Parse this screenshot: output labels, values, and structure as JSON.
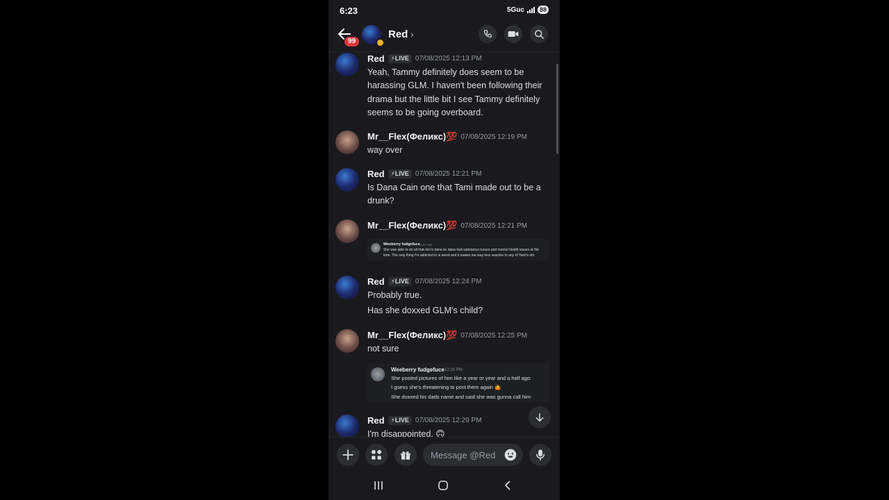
{
  "status_bar": {
    "time": "6:23",
    "network": "5Guc",
    "battery": "88"
  },
  "header": {
    "title": "Red",
    "unread_count": "99",
    "chevron": "›"
  },
  "icons": {
    "back": "arrow-left-icon",
    "call": "phone-icon",
    "video": "video-camera-icon",
    "search": "search-icon",
    "add": "plus-icon",
    "apps": "apps-icon",
    "gift": "gift-icon",
    "emoji": "emoji-icon",
    "mic": "microphone-icon",
    "jump": "arrow-down-icon",
    "recents": "recents-icon",
    "home": "home-icon",
    "nav_back": "chevron-left-icon"
  },
  "colors": {
    "background": "#1a1a1e",
    "badge": "#da373c",
    "idle": "#f0b232",
    "text": "#dbdee1"
  },
  "messages": [
    {
      "author": "Red",
      "tag": "⚡LIVE",
      "timestamp": "07/08/2025 12:13 PM",
      "lines": [
        "Yeah, Tammy definitely does seem to be harassing GLM. I haven't been following their drama but the little bit I see Tammy definitely seems to be going overboard."
      ]
    },
    {
      "author": "Mr__Flex(Феликс)💯",
      "timestamp": "07/08/2025 12:19 PM",
      "lines": [
        "way over"
      ]
    },
    {
      "author": "Red",
      "tag": "⚡LIVE",
      "timestamp": "07/08/2025 12:21 PM",
      "lines": [
        "Is Dana Cain one that Tami made out to be a drunk?"
      ]
    },
    {
      "author": "Mr__Flex(Феликс)💯",
      "timestamp": "07/08/2025 12:21 PM",
      "embed": {
        "name": "Weeberry fudgefuce",
        "time": "11:57 AM",
        "lines": [
          "She was able to do all that sht to dana bc dana had substance issues and mental health issues at the",
          "time. The only thing I'm addicted to is weed and it makes me way less reactive to any of Tami's sht"
        ]
      }
    },
    {
      "author": "Red",
      "tag": "⚡LIVE",
      "timestamp": "07/08/2025 12:24 PM",
      "lines": [
        "Probably true.",
        "Has she doxxed GLM's child?"
      ]
    },
    {
      "author": "Mr__Flex(Феликс)💯",
      "timestamp": "07/08/2025 12:25 PM",
      "lines": [
        "not sure"
      ],
      "embed": {
        "name": "Weeberry fudgefuce",
        "time": "12:26 PM",
        "lines": [
          "She posted pictures of him like a year or year and a half ago.",
          "I guess she's threatening to post them again 🤷",
          "She doxxed his dads name and said she was gunna call him"
        ]
      }
    },
    {
      "author": "Red",
      "tag": "⚡LIVE",
      "timestamp": "07/08/2025 12:29 PM",
      "lines": [
        "I'm disappointed. 🙃"
      ]
    }
  ],
  "composer": {
    "placeholder": "Message @Red"
  }
}
